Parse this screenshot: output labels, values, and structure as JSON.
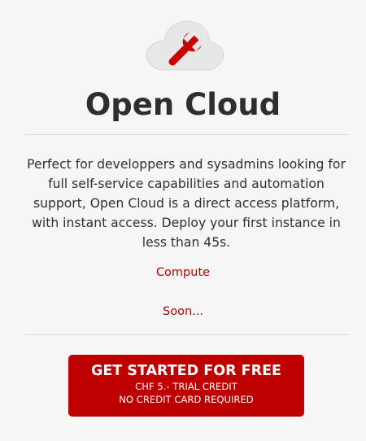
{
  "brand": {
    "title": "Open Cloud",
    "logo_icon": "cloud-wrench-icon",
    "accent_color": "#bf0000"
  },
  "description": "Perfect for developpers and sysadmins looking for full self-service capabilities and automation support, Open Cloud is a direct access platform, with instant access. Deploy your first instance in less than 45s.",
  "links": {
    "compute": "Compute",
    "soon": "Soon..."
  },
  "cta": {
    "title": "GET STARTED FOR FREE",
    "line1": "CHF 5.- TRIAL CREDIT",
    "line2": "NO CREDIT CARD REQUIRED"
  }
}
